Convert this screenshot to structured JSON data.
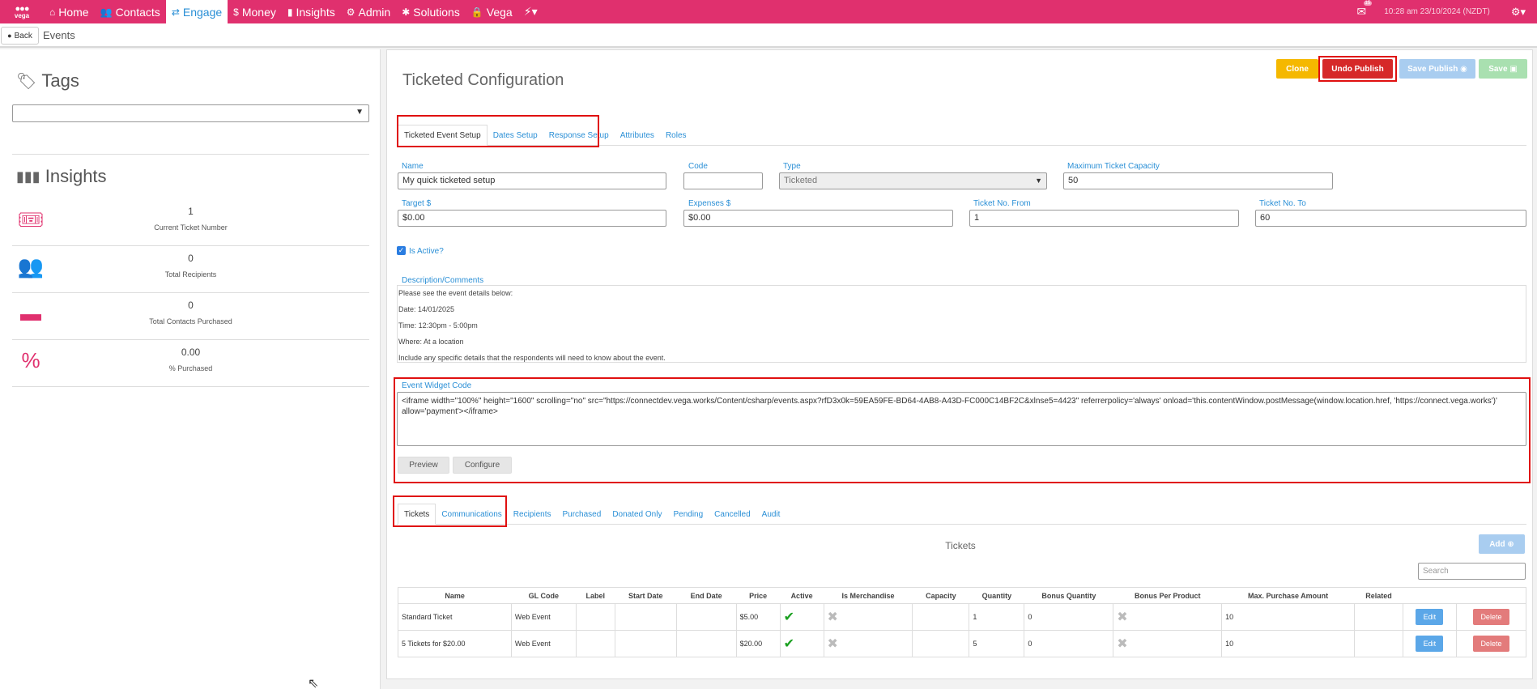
{
  "nav": {
    "logo_text": "vega",
    "items": [
      {
        "label": "Home",
        "icon": "home-icon"
      },
      {
        "label": "Contacts",
        "icon": "users-icon"
      },
      {
        "label": "Engage",
        "icon": "exchange-icon"
      },
      {
        "label": "Money",
        "icon": "dollar-icon"
      },
      {
        "label": "Insights",
        "icon": "bar-chart-icon"
      },
      {
        "label": "Admin",
        "icon": "cogs-icon"
      },
      {
        "label": "Solutions",
        "icon": "puzzle-icon"
      },
      {
        "label": "Vega",
        "icon": "lock-icon"
      }
    ],
    "notification_count": "15",
    "clock": "10:28 am 23/10/2024 (NZDT)"
  },
  "subbar": {
    "back_label": "Back",
    "breadcrumb": "Events"
  },
  "left": {
    "tags_title": "Tags",
    "tags_value": "",
    "insights_title": "Insights",
    "stats": [
      {
        "value": "1",
        "label": "Current Ticket Number",
        "icon": "ticket-icon"
      },
      {
        "value": "0",
        "label": "Total Recipients",
        "icon": "users-icon"
      },
      {
        "value": "0",
        "label": "Total Contacts Purchased",
        "icon": "credit-card-icon"
      },
      {
        "value": "0.00",
        "label": "% Purchased",
        "icon": "percent-icon"
      }
    ]
  },
  "main": {
    "title": "Ticketed Configuration",
    "actions": {
      "clone": "Clone",
      "undo_publish": "Undo Publish",
      "save_publish": "Save Publish",
      "save": "Save"
    },
    "config_tabs": [
      "Ticketed Event Setup",
      "Dates Setup",
      "Response Setup",
      "Attributes",
      "Roles"
    ],
    "fields": {
      "name_label": "Name",
      "name_value": "My quick ticketed setup",
      "code_label": "Code",
      "code_value": "",
      "type_label": "Type",
      "type_value": "Ticketed",
      "max_capacity_label": "Maximum Ticket Capacity",
      "max_capacity_value": "50",
      "target_label": "Target $",
      "target_value": "$0.00",
      "expenses_label": "Expenses $",
      "expenses_value": "$0.00",
      "ticket_from_label": "Ticket No. From",
      "ticket_from_value": "1",
      "ticket_to_label": "Ticket No. To",
      "ticket_to_value": "60",
      "is_active_label": "Is Active?"
    },
    "description": {
      "label": "Description/Comments",
      "lines": [
        "Please see the event details below:",
        "Date: 14/01/2025",
        "Time: 12:30pm - 5:00pm",
        "Where: At a location",
        "Include any specific details that the respondents will need to know about the event."
      ]
    },
    "widget": {
      "label": "Event Widget Code",
      "code": "<iframe width=\"100%\" height=\"1600\" scrolling=\"no\" src=\"https://connectdev.vega.works/Content/csharp/events.aspx?rfD3x0k=59EA59FE-BD64-4AB8-A43D-FC000C14BF2C&xlnse5=4423\" referrerpolicy='always' onload='this.contentWindow.postMessage(window.location.href, 'https://connect.vega.works')' allow='payment'></iframe>",
      "preview": "Preview",
      "configure": "Configure"
    },
    "ticket_tabs": [
      "Tickets",
      "Communications",
      "Recipients",
      "Purchased",
      "Donated Only",
      "Pending",
      "Cancelled",
      "Audit"
    ],
    "tickets": {
      "title": "Tickets",
      "add": "Add",
      "search_placeholder": "Search",
      "columns": [
        "Name",
        "GL Code",
        "Label",
        "Start Date",
        "End Date",
        "Price",
        "Active",
        "Is Merchandise",
        "Capacity",
        "Quantity",
        "Bonus Quantity",
        "Bonus Per Product",
        "Max. Purchase Amount",
        "Related",
        "",
        ""
      ],
      "rows": [
        {
          "name": "Standard Ticket",
          "gl_code": "Web Event",
          "label": "",
          "start_date": "",
          "end_date": "",
          "price": "$5.00",
          "active": true,
          "merch": false,
          "capacity": "",
          "quantity": "1",
          "bonus_qty": "0",
          "bonus_per": false,
          "max_purchase": "10",
          "related": "",
          "edit": "Edit",
          "delete": "Delete"
        },
        {
          "name": "5 Tickets for $20.00",
          "gl_code": "Web Event",
          "label": "",
          "start_date": "",
          "end_date": "",
          "price": "$20.00",
          "active": true,
          "merch": false,
          "capacity": "",
          "quantity": "5",
          "bonus_qty": "0",
          "bonus_per": false,
          "max_purchase": "10",
          "related": "",
          "edit": "Edit",
          "delete": "Delete"
        }
      ]
    }
  },
  "colors": {
    "brand": "#e0306e",
    "link": "#2a8fd6",
    "clone": "#f5b800",
    "undo": "#d62828",
    "save_publish": "#a9cdf0",
    "save": "#a9e0b0"
  }
}
